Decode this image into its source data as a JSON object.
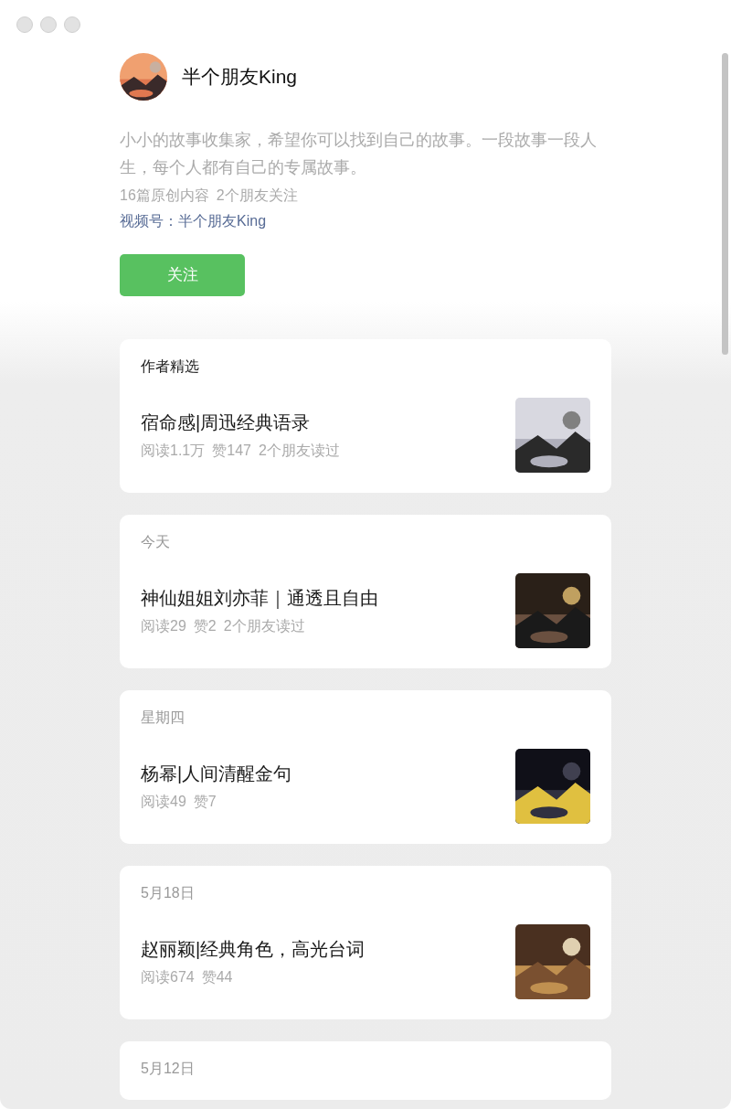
{
  "profile": {
    "name": "半个朋友King",
    "bio": "小小的故事收集家，希望你可以找到自己的故事。一段故事一段人生，每个人都有自己的专属故事。",
    "stats": [
      "16篇原创内容",
      "2个朋友关注"
    ],
    "channel_link": "视频号：半个朋友King",
    "follow_button": "关注"
  },
  "sections": [
    {
      "label": "作者精选",
      "kind": "featured",
      "articles": [
        {
          "title": "宿命感|周迅经典语录",
          "stats": [
            "阅读1.1万",
            "赞147",
            "2个朋友读过"
          ]
        }
      ]
    },
    {
      "label": "今天",
      "kind": "date",
      "articles": [
        {
          "title": "神仙姐姐刘亦菲｜通透且自由",
          "stats": [
            "阅读29",
            "赞2",
            "2个朋友读过"
          ]
        }
      ]
    },
    {
      "label": "星期四",
      "kind": "date",
      "articles": [
        {
          "title": "杨幂|人间清醒金句",
          "stats": [
            "阅读49",
            "赞7"
          ]
        }
      ]
    },
    {
      "label": "5月18日",
      "kind": "date",
      "articles": [
        {
          "title": "赵丽颖|经典角色，高光台词",
          "stats": [
            "阅读674",
            "赞44"
          ]
        }
      ]
    },
    {
      "label": "5月12日",
      "kind": "date"
    }
  ]
}
